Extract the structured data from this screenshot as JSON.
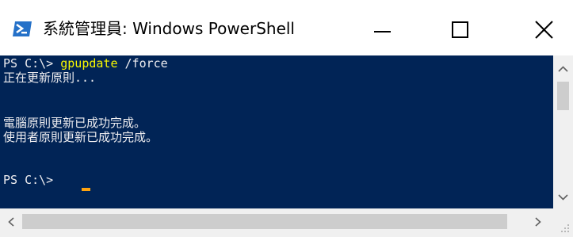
{
  "window": {
    "title": "系統管理員: Windows PowerShell",
    "icon": "powershell-icon",
    "controls": {
      "minimize_icon": "minimize-icon",
      "maximize_icon": "maximize-icon",
      "close_icon": "close-icon"
    },
    "colors": {
      "console_background": "#012456",
      "console_text": "#eeedf0",
      "command_text": "#f8f800",
      "cursor": "#fea30f",
      "scrollbar_track": "#f0f0f0",
      "scrollbar_thumb": "#cdcdcd"
    }
  },
  "console": {
    "lines": [
      {
        "prompt": "PS C:\\> ",
        "command": "gpupdate",
        "args": " /force"
      },
      {
        "text": "正在更新原則..."
      },
      {
        "text": ""
      },
      {
        "text": "電腦原則更新已成功完成。"
      },
      {
        "text": "使用者原則更新已成功完成。"
      },
      {
        "text": ""
      },
      {
        "prompt": "PS C:\\> "
      }
    ]
  },
  "scrollbars": {
    "vertical": {
      "up_icon": "chevron-up-icon",
      "down_icon": "chevron-down-icon"
    },
    "horizontal": {
      "left_icon": "chevron-left-icon",
      "right_icon": "chevron-right-icon"
    },
    "resize_grip_icon": "resize-grip-icon"
  }
}
